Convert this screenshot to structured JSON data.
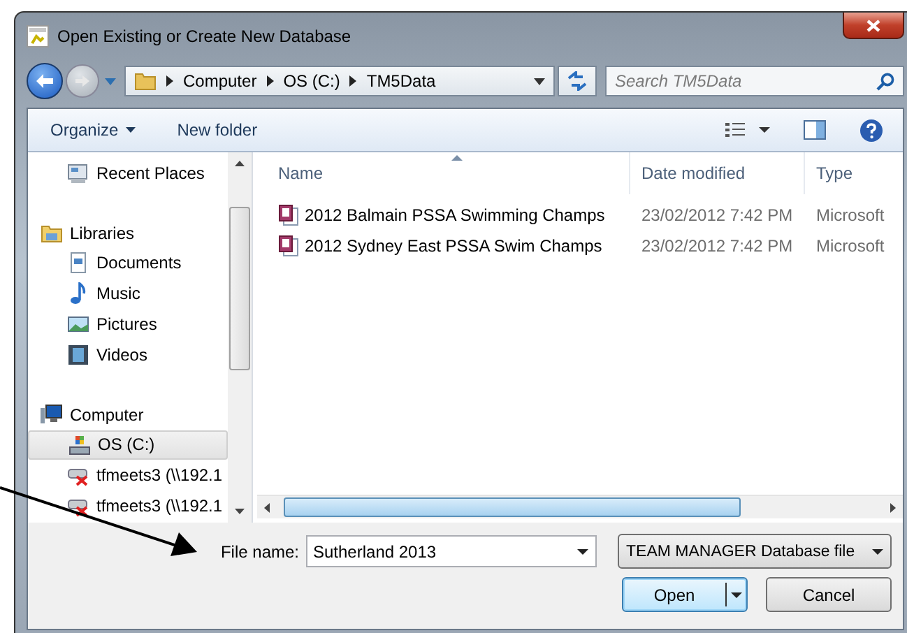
{
  "window": {
    "title": "Open Existing or Create New Database"
  },
  "address": {
    "crumbs": [
      "Computer",
      "OS (C:)",
      "TM5Data"
    ],
    "search_placeholder": "Search TM5Data"
  },
  "toolbar": {
    "organize": "Organize",
    "new_folder": "New folder"
  },
  "nav": {
    "sections": [
      {
        "children": [
          {
            "label": "Recent Places",
            "kind": "recent",
            "selected": false
          }
        ]
      },
      {
        "label": "Libraries",
        "kind": "libraries",
        "selected": false,
        "children": [
          {
            "label": "Documents",
            "kind": "documents",
            "selected": false
          },
          {
            "label": "Music",
            "kind": "music",
            "selected": false
          },
          {
            "label": "Pictures",
            "kind": "pictures",
            "selected": false
          },
          {
            "label": "Videos",
            "kind": "videos",
            "selected": false
          }
        ]
      },
      {
        "label": "Computer",
        "kind": "computer",
        "selected": false,
        "children": [
          {
            "label": "OS (C:)",
            "kind": "drive",
            "selected": true
          },
          {
            "label": "tfmeets3 (\\\\192.1",
            "kind": "network",
            "selected": false
          },
          {
            "label": "tfmeets3 (\\\\192.1",
            "kind": "network",
            "selected": false
          }
        ]
      }
    ]
  },
  "table": {
    "columns": [
      "Name",
      "Date modified",
      "Type"
    ],
    "rows": [
      {
        "name": "2012 Balmain PSSA Swimming Champs",
        "date": "23/02/2012 7:42 PM",
        "type": "Microsoft"
      },
      {
        "name": "2012 Sydney East PSSA Swim Champs",
        "date": "23/02/2012 7:42 PM",
        "type": "Microsoft"
      }
    ]
  },
  "footer": {
    "file_name_label": "File name:",
    "file_name": "Sutherland 2013",
    "filter": "TEAM MANAGER Database file",
    "buttons": [
      "Open",
      "Cancel"
    ]
  }
}
